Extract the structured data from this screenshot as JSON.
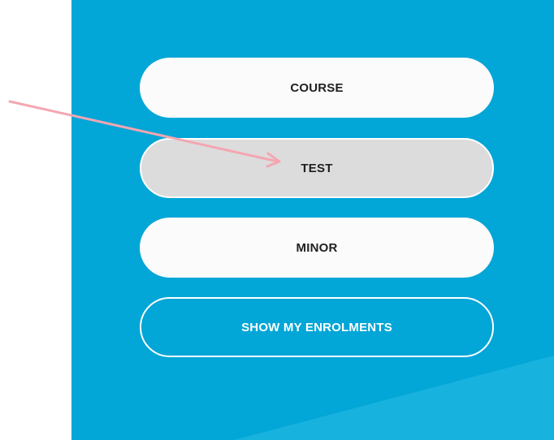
{
  "buttons": {
    "course": "COURSE",
    "test": "TEST",
    "minor": "MINOR",
    "show_enrolments": "SHOW MY ENROLMENTS"
  },
  "colors": {
    "panel": "#02a6d7",
    "selected_button": "#dcdcdc",
    "button": "#fbfbfb",
    "annotation_arrow": "#f4a6b1"
  },
  "state": {
    "selected": "test"
  }
}
